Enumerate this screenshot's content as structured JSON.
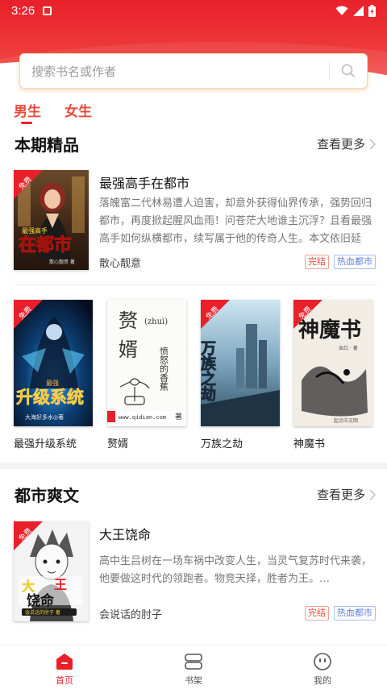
{
  "status_bar": {
    "time": "3:26"
  },
  "search": {
    "placeholder": "搜索书名或作者"
  },
  "gender_tabs": [
    {
      "label": "男生",
      "active": true
    },
    {
      "label": "女生",
      "active": false
    }
  ],
  "badges": {
    "free": "免费"
  },
  "sections": [
    {
      "title": "本期精品",
      "more_label": "查看更多",
      "featured": {
        "title": "最强高手在都市",
        "description": "落魄富二代林易遭人迫害，却意外获得仙界传承，强势回归都市，再度掀起腥风血雨！问苍茫大地谁主沉浮？且看最强高手如何纵横都市，续写属于他的传奇人生。本文依旧延续…",
        "author": "散心靓意",
        "status_tag": "完结",
        "genre_tag": "热血都市",
        "cover_text": {
          "top": "最强高手",
          "main": "在都市",
          "sub": "散心靓意 著"
        }
      },
      "grid": [
        {
          "title": "最强升级系统",
          "cover_text": {
            "top": "最强",
            "main": "升级系统",
            "sub": "大海好多水◎著"
          }
        },
        {
          "title": "赘婿",
          "cover_text": {
            "line1": "赘",
            "line2": "婿",
            "pinyin": "(zhuì)",
            "side": "愤怒的香蕉",
            "author": "著",
            "url": "www.qidian.com"
          }
        },
        {
          "title": "万族之劫",
          "cover_text": {
            "main": "万族之劫"
          }
        },
        {
          "title": "神魔书",
          "cover_text": {
            "main": "神魔书",
            "author": "血红 · 著",
            "publisher": "起点中文网"
          }
        }
      ]
    },
    {
      "title": "都市爽文",
      "more_label": "查看更多",
      "featured": {
        "title": "大王饶命",
        "description": "高中生吕树在一场车祸中改变人生，当灵气复苏时代来袭，他要做这时代的领跑者。物竞天择，胜者为王。…",
        "author": "会说话的肘子",
        "status_tag": "完结",
        "genre_tag": "热血都市",
        "cover_text": {
          "main1": "大",
          "main2": "王",
          "main3": "饶命",
          "sub": "会说话的肘子 著"
        }
      }
    }
  ],
  "bottom_nav": [
    {
      "label": "首页",
      "icon": "home-icon",
      "active": true
    },
    {
      "label": "书架",
      "icon": "bookshelf-icon",
      "active": false
    },
    {
      "label": "我的",
      "icon": "profile-icon",
      "active": false
    }
  ],
  "colors": {
    "brand_red": "#e8202a",
    "tag_blue": "#5b7fd6",
    "search_glow": "#f3d7b0"
  }
}
